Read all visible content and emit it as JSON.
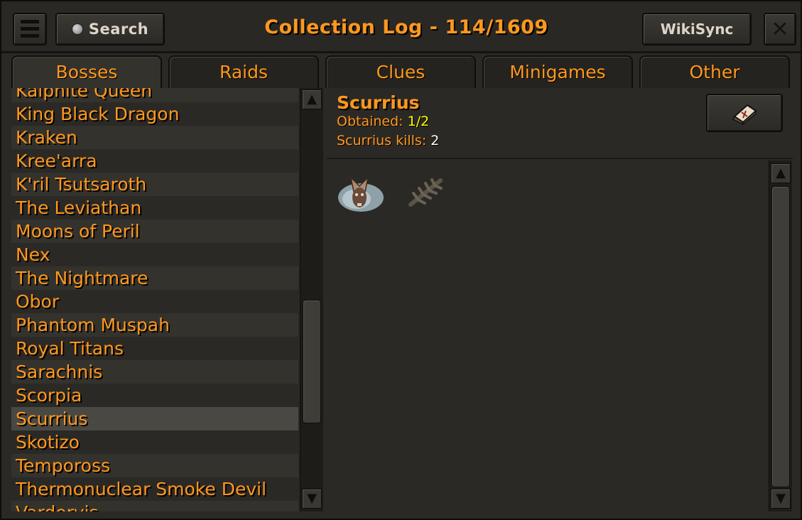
{
  "header": {
    "title": "Collection Log - 114/1609",
    "search_label": "Search",
    "wikisync_label": "WikiSync"
  },
  "tabs": [
    {
      "label": "Bosses",
      "active": true
    },
    {
      "label": "Raids",
      "active": false
    },
    {
      "label": "Clues",
      "active": false
    },
    {
      "label": "Minigames",
      "active": false
    },
    {
      "label": "Other",
      "active": false
    }
  ],
  "sidebar": {
    "items": [
      {
        "label": "Kalphite Queen"
      },
      {
        "label": "King Black Dragon"
      },
      {
        "label": "Kraken"
      },
      {
        "label": "Kree'arra"
      },
      {
        "label": "K'ril Tsutsaroth"
      },
      {
        "label": "The Leviathan"
      },
      {
        "label": "Moons of Peril"
      },
      {
        "label": "Nex"
      },
      {
        "label": "The Nightmare"
      },
      {
        "label": "Obor"
      },
      {
        "label": "Phantom Muspah"
      },
      {
        "label": "Royal Titans"
      },
      {
        "label": "Sarachnis"
      },
      {
        "label": "Scorpia"
      },
      {
        "label": "Scurrius",
        "selected": true
      },
      {
        "label": "Skotizo"
      },
      {
        "label": "Tempoross"
      },
      {
        "label": "Thermonuclear Smoke Devil"
      },
      {
        "label": "Vardorvis"
      }
    ]
  },
  "detail": {
    "name": "Scurrius",
    "obtained_label": "Obtained: ",
    "obtained_value": "1/2",
    "kills_label": "Scurrius kills: ",
    "kills_value": "2",
    "items": [
      {
        "icon": "scurrius-pet-icon",
        "obtained": true
      },
      {
        "icon": "spine-item-icon",
        "obtained": false
      }
    ]
  },
  "colors": {
    "text_orange": "#ff981f",
    "obtained_yellow": "#ffff00",
    "kills_white": "#ffffff",
    "background": "#2b2925"
  }
}
